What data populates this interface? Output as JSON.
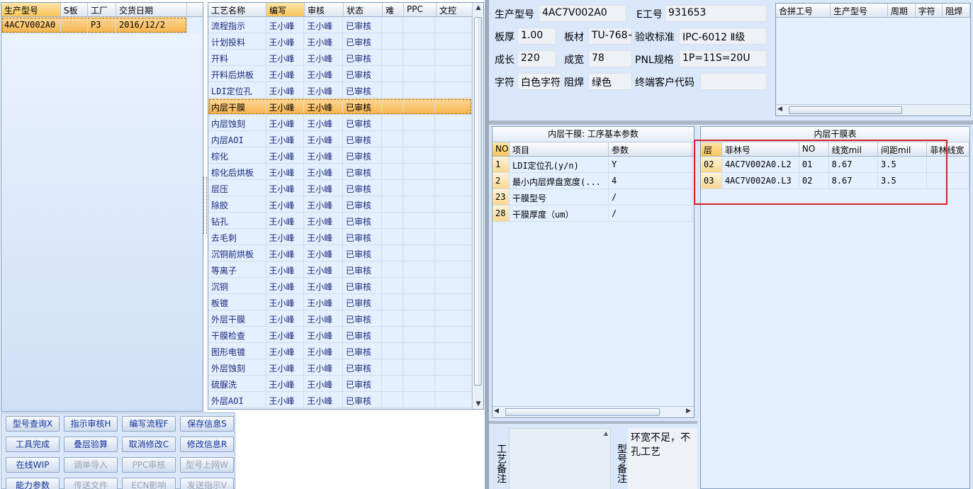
{
  "product_list": {
    "headers": [
      "生产型号",
      "S板",
      "工厂",
      "交货日期"
    ],
    "rows": [
      [
        "4AC7V002A0",
        "",
        "P3",
        "2016/12/2"
      ]
    ]
  },
  "process_list": {
    "headers": [
      "工艺名称",
      "编写",
      "审核",
      "状态",
      "难",
      "PPC",
      "文控"
    ],
    "rows": [
      [
        "流程指示",
        "王小峰",
        "王小峰",
        "已审核"
      ],
      [
        "计划投料",
        "王小峰",
        "王小峰",
        "已审核"
      ],
      [
        "开料",
        "王小峰",
        "王小峰",
        "已审核"
      ],
      [
        "开料后烘板",
        "王小峰",
        "王小峰",
        "已审核"
      ],
      [
        "LDI定位孔",
        "王小峰",
        "王小峰",
        "已审核"
      ],
      [
        "内层干膜",
        "王小峰",
        "王小峰",
        "已审核"
      ],
      [
        "内层蚀刻",
        "王小峰",
        "王小峰",
        "已审核"
      ],
      [
        "内层AOI",
        "王小峰",
        "王小峰",
        "已审核"
      ],
      [
        "棕化",
        "王小峰",
        "王小峰",
        "已审核"
      ],
      [
        "棕化后烘板",
        "王小峰",
        "王小峰",
        "已审核"
      ],
      [
        "层压",
        "王小峰",
        "王小峰",
        "已审核"
      ],
      [
        "除胶",
        "王小峰",
        "王小峰",
        "已审核"
      ],
      [
        "钻孔",
        "王小峰",
        "王小峰",
        "已审核"
      ],
      [
        "去毛刺",
        "王小峰",
        "王小峰",
        "已审核"
      ],
      [
        "沉铜前烘板",
        "王小峰",
        "王小峰",
        "已审核"
      ],
      [
        "等离子",
        "王小峰",
        "王小峰",
        "已审核"
      ],
      [
        "沉铜",
        "王小峰",
        "王小峰",
        "已审核"
      ],
      [
        "板镀",
        "王小峰",
        "王小峰",
        "已审核"
      ],
      [
        "外层干膜",
        "王小峰",
        "王小峰",
        "已审核"
      ],
      [
        "干膜检查",
        "王小峰",
        "王小峰",
        "已审核"
      ],
      [
        "图形电镀",
        "王小峰",
        "王小峰",
        "已审核"
      ],
      [
        "外层蚀刻",
        "王小峰",
        "王小峰",
        "已审核"
      ],
      [
        "硫脲洗",
        "王小峰",
        "王小峰",
        "已审核"
      ],
      [
        "外层AOI",
        "王小峰",
        "王小峰",
        "已审核"
      ]
    ],
    "selected_index": 5
  },
  "buttons": [
    {
      "label": "型号查询X",
      "enabled": true
    },
    {
      "label": "指示审核H",
      "enabled": true
    },
    {
      "label": "编写流程F",
      "enabled": true
    },
    {
      "label": "保存信息S",
      "enabled": true
    },
    {
      "label": "工具完成",
      "enabled": true
    },
    {
      "label": "叠层验算",
      "enabled": true
    },
    {
      "label": "取消修改C",
      "enabled": true
    },
    {
      "label": "修改信息R",
      "enabled": true
    },
    {
      "label": "在线WIP",
      "enabled": true
    },
    {
      "label": "调单导入",
      "enabled": false
    },
    {
      "label": "PPC审核",
      "enabled": false
    },
    {
      "label": "型号上网W",
      "enabled": false
    },
    {
      "label": "能力参数",
      "enabled": true
    },
    {
      "label": "传送文件",
      "enabled": false
    },
    {
      "label": "ECN影响",
      "enabled": false
    },
    {
      "label": "发送指示V",
      "enabled": false
    }
  ],
  "info": {
    "product_no_label": "生产型号",
    "product_no": "4AC7V002A0",
    "eng_no_label": "E工号",
    "eng_no": "931653",
    "thickness_label": "板厚",
    "thickness": "1.00",
    "material_label": "板材",
    "material": "TU-768+",
    "standard_label": "验收标准",
    "standard": "IPC-6012 Ⅱ级",
    "length_label": "成长",
    "length": "220",
    "width_label": "成宽",
    "width": "78",
    "pnl_label": "PNL规格",
    "pnl": "1P=11S=20U",
    "char_label": "字符",
    "char": "白色字符",
    "mask_label": "阻焊",
    "mask": "绿色",
    "customer_label": "终端客户代码",
    "customer": ""
  },
  "combined": {
    "headers": [
      "合拼工号",
      "生产型号",
      "周期",
      "字符",
      "阻焊"
    ]
  },
  "base_params": {
    "title": "内层干膜: 工序基本参数",
    "headers": [
      "NO",
      "项目",
      "参数"
    ],
    "rows": [
      [
        "1",
        "LDI定位孔(y/n)",
        "Y"
      ],
      [
        "2",
        "最小内层焊盘宽度(...",
        "4"
      ],
      [
        "23",
        "干膜型号",
        "/"
      ],
      [
        "28",
        "干膜厚度（um）",
        "/"
      ]
    ]
  },
  "film_table": {
    "title": "内层干膜表",
    "headers": [
      "层",
      "菲林号",
      "NO",
      "线宽mil",
      "间距mil",
      "菲林线宽"
    ],
    "rows": [
      [
        "02",
        "4AC7V002A0.L2",
        "01",
        "8.67",
        "3.5",
        ""
      ],
      [
        "03",
        "4AC7V002A0.L3",
        "02",
        "8.67",
        "3.5",
        ""
      ]
    ]
  },
  "notes": {
    "process_label": "工艺备注",
    "model_label": "型号备注",
    "model_text": "环宽不足，不孔工艺"
  },
  "colors": {
    "accent_selected": "#f6b34e",
    "highlight_box": "#d62020",
    "grid_bg": "#e4efff"
  }
}
